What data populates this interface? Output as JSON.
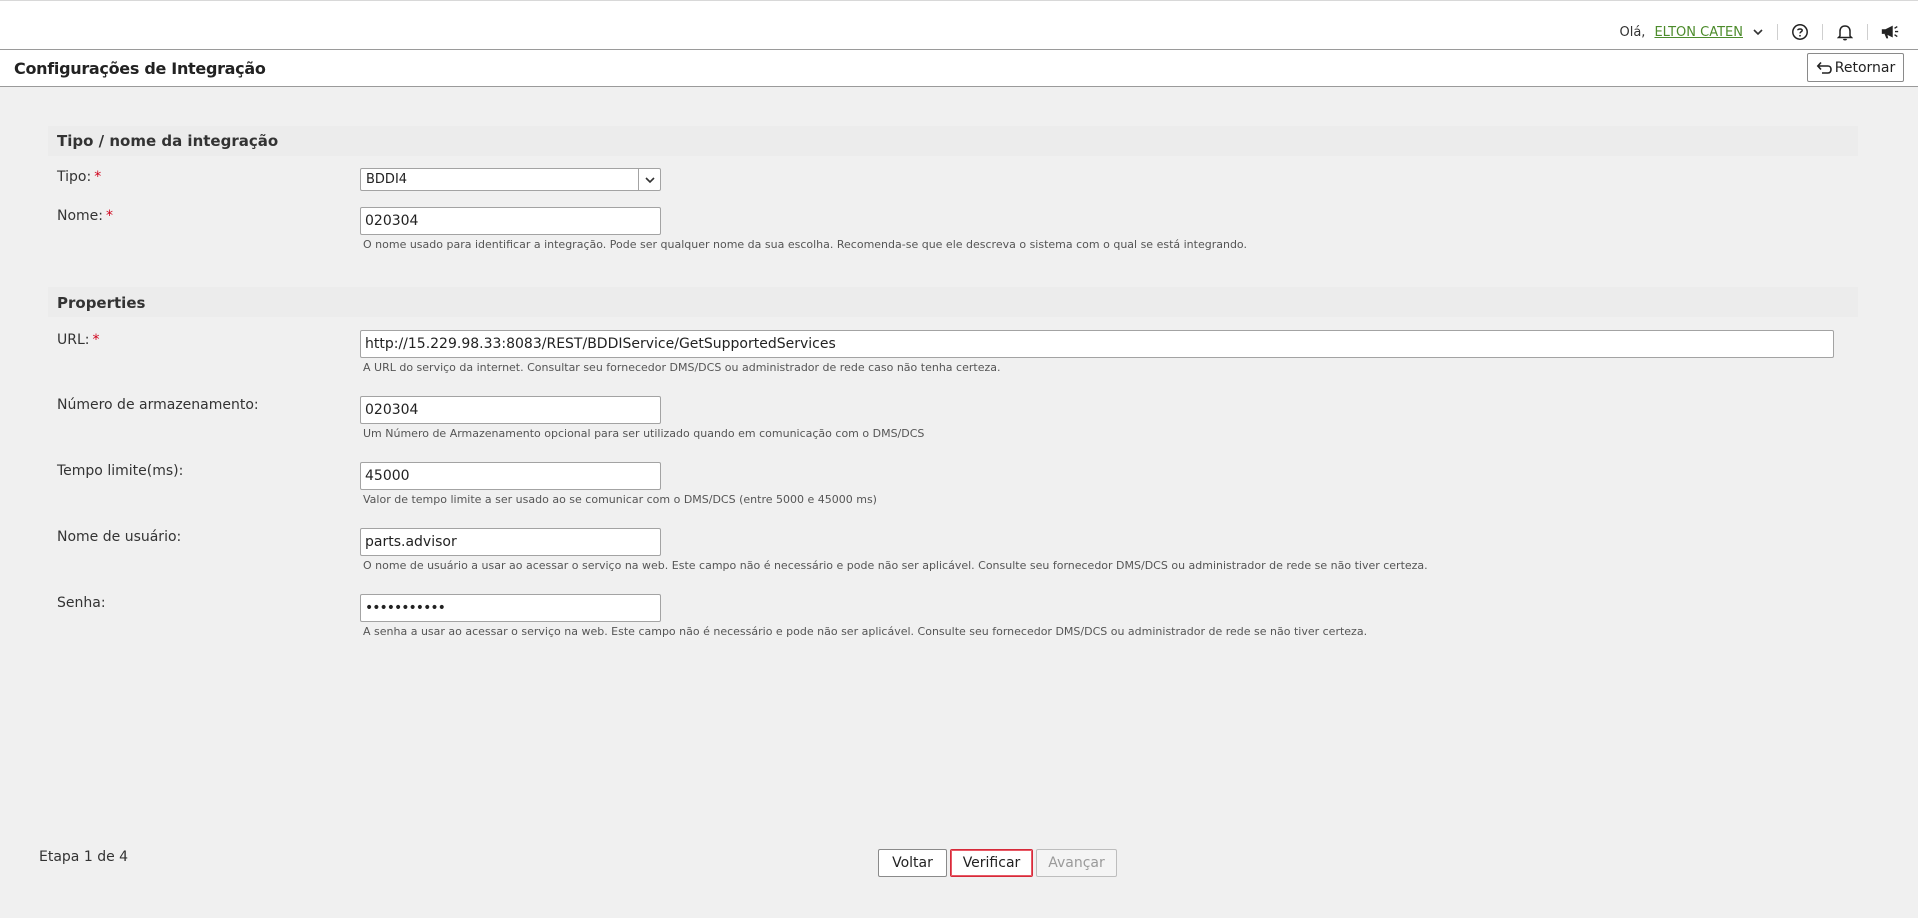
{
  "header": {
    "greeting": "Olá,",
    "user_name": "ELTON CATEN"
  },
  "subheader": {
    "title": "Configurações de Integração",
    "back_label": "Retornar"
  },
  "sections": {
    "integration": {
      "title": "Tipo / nome da integração",
      "tipo_label": "Tipo:",
      "tipo_value": "BDDI4",
      "nome_label": "Nome:",
      "nome_value": "020304",
      "nome_help": "O nome usado para identificar a integração. Pode ser qualquer nome da sua escolha. Recomenda-se que ele descreva o sistema com o qual se está integrando."
    },
    "properties": {
      "title": "Properties",
      "url_label": "URL:",
      "url_value": "http://15.229.98.33:8083/REST/BDDIService/GetSupportedServices",
      "url_help": "A URL do serviço da internet. Consultar seu fornecedor DMS/DCS ou administrador de rede caso não tenha certeza.",
      "storage_label": "Número de armazenamento:",
      "storage_value": "020304",
      "storage_help": "Um Número de Armazenamento opcional para ser utilizado quando em comunicação com o DMS/DCS",
      "timeout_label": "Tempo limite(ms):",
      "timeout_value": "45000",
      "timeout_help": "Valor de tempo limite a ser usado ao se comunicar com o DMS/DCS (entre 5000 e 45000 ms)",
      "username_label": "Nome de usuário:",
      "username_value": "parts.advisor",
      "username_help": "O nome de usuário a usar ao acessar o serviço na web. Este campo não é necessário e pode não ser aplicável. Consulte seu fornecedor DMS/DCS ou administrador de rede se não tiver certeza.",
      "password_label": "Senha:",
      "password_value": "•••••••••••",
      "password_help": "A senha a usar ao acessar o serviço na web. Este campo não é necessário e pode não ser aplicável. Consulte seu fornecedor DMS/DCS ou administrador de rede se não tiver certeza."
    }
  },
  "required_marker": "*",
  "footer": {
    "step": "Etapa 1 de 4",
    "back_label": "Voltar",
    "verify_label": "Verificar",
    "next_label": "Avançar"
  },
  "icons": {
    "user_menu": "chevron-down-icon",
    "help": "help-circle-icon",
    "notifications": "bell-icon",
    "announcements": "megaphone-icon",
    "back": "undo-arrow-icon",
    "select": "chevron-down-icon"
  },
  "colors": {
    "user_link": "#4c8b2b",
    "required": "#d0021b",
    "verify_border": "#d62a3a"
  }
}
